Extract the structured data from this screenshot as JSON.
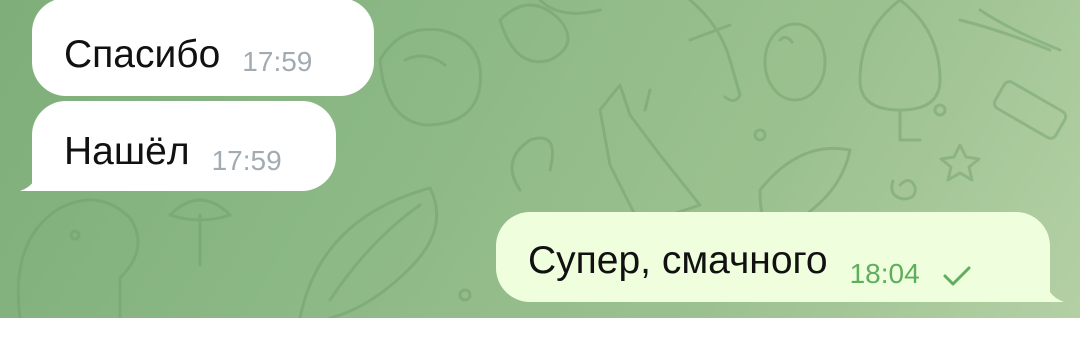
{
  "colors": {
    "chat_background": "#8bb885",
    "incoming_bubble": "#ffffff",
    "outgoing_bubble": "#effedd",
    "incoming_time": "#a2aab2",
    "outgoing_time": "#5fae5c",
    "bottom_bar": "#ffffff"
  },
  "messages": [
    {
      "direction": "incoming",
      "text": "Спасибо",
      "time": "17:59"
    },
    {
      "direction": "incoming",
      "text": "Нашёл",
      "time": "17:59"
    },
    {
      "direction": "outgoing",
      "text": "Супер, смачного",
      "time": "18:04",
      "status_icon": "check-icon"
    }
  ]
}
